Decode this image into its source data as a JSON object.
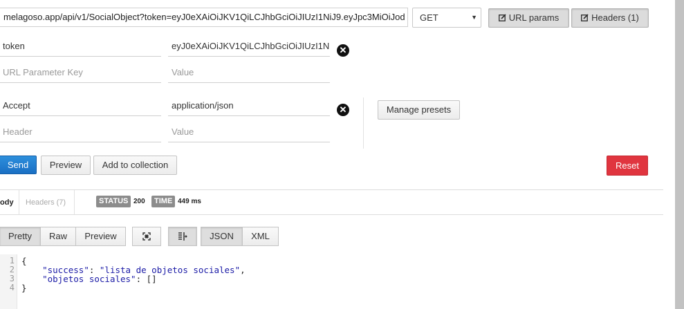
{
  "request": {
    "url": "melagoso.app/api/v1/SocialObject?token=eyJ0eXAiOiJKV1QiLCJhbGciOiJIUzI1NiJ9.eyJpc3MiOiJod",
    "method": "GET",
    "url_params_label": "URL params",
    "headers_label": "Headers (1)"
  },
  "url_params": {
    "rows": [
      {
        "key": "token",
        "value": "eyJ0eXAiOiJKV1QiLCJhbGciOiJIUzI1N"
      }
    ],
    "key_placeholder": "URL Parameter Key",
    "value_placeholder": "Value"
  },
  "headers": {
    "rows": [
      {
        "key": "Accept",
        "value": "application/json"
      }
    ],
    "key_placeholder": "Header",
    "value_placeholder": "Value",
    "manage_presets_label": "Manage presets"
  },
  "actions": {
    "send": "Send",
    "preview": "Preview",
    "add_to_collection": "Add to collection",
    "reset": "Reset"
  },
  "response": {
    "tab_body": "ody",
    "tab_headers": "Headers (7)",
    "status_label": "STATUS",
    "status_value": "200",
    "time_label": "TIME",
    "time_value": "449 ms",
    "view_modes": [
      "Pretty",
      "Raw",
      "Preview"
    ],
    "formats": [
      "JSON",
      "XML"
    ],
    "line_numbers": [
      "1",
      "2",
      "3",
      "4"
    ],
    "code": {
      "open": "{",
      "line2_key": "\"success\"",
      "line2_val": "\"lista de objetos sociales\"",
      "line3_key": "\"objetos sociales\"",
      "line3_val": "[]",
      "close": "}"
    }
  },
  "icons": {
    "remove": "circle-x-icon",
    "edit": "edit-icon",
    "fullscreen": "fullscreen-icon",
    "wrap": "wrap-lines-icon"
  }
}
